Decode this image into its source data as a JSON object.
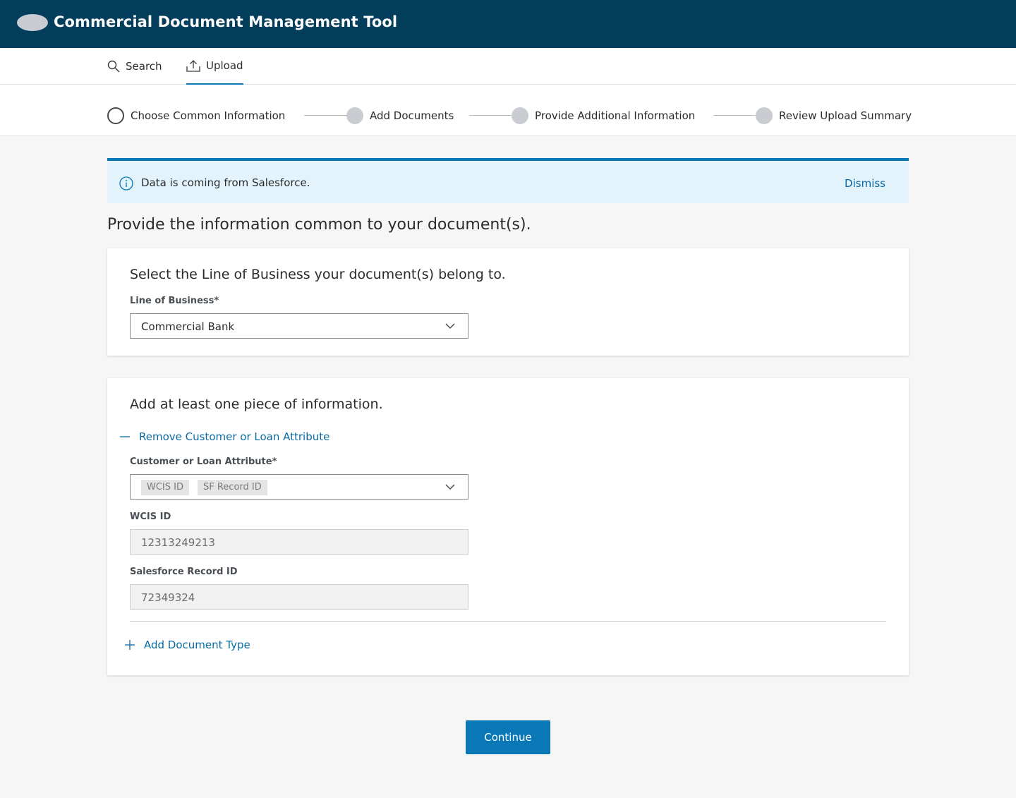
{
  "header": {
    "title": "Commercial Document Management Tool",
    "logo_icon": "cloud-logo-icon"
  },
  "nav": {
    "search_label": "Search",
    "upload_label": "Upload",
    "active": "Upload"
  },
  "stepper": {
    "steps": [
      {
        "label": "Choose Common Information",
        "state": "current"
      },
      {
        "label": "Add Documents",
        "state": "upcoming"
      },
      {
        "label": "Provide Additional Information",
        "state": "upcoming"
      },
      {
        "label": "Review Upload Summary",
        "state": "upcoming"
      }
    ]
  },
  "alert": {
    "text": "Data is coming from Salesforce.",
    "dismiss_label": "Dismiss",
    "icon": "info-icon"
  },
  "main": {
    "heading": "Provide the information common to your document(s)."
  },
  "lob_card": {
    "heading": "Select the Line of Business your document(s) belong to.",
    "field_label": "Line of Business*",
    "selected_value": "Commercial Bank"
  },
  "info_card": {
    "heading": "Add at least one piece of information.",
    "remove_link": "Remove Customer or Loan Attribute",
    "attribute_label": "Customer or Loan Attribute*",
    "attribute_chips": [
      "WCIS ID",
      "SF Record ID"
    ],
    "wcis_label": "WCIS ID",
    "wcis_value": "12313249213",
    "sf_label": "Salesforce Record ID",
    "sf_value": "72349324",
    "add_doc_link": "Add Document Type"
  },
  "footer": {
    "continue_label": "Continue"
  },
  "colors": {
    "header_bg": "#033d5c",
    "accent": "#0a78b7",
    "alert_bg": "#e2f3fb",
    "page_bg": "#f6f6f6"
  }
}
